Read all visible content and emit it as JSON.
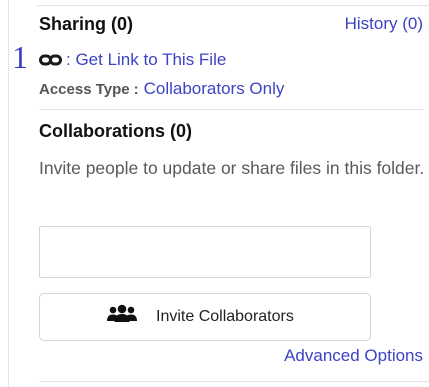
{
  "annotation": {
    "number": "1"
  },
  "sharing": {
    "title": "Sharing (0)",
    "history_link": "History (0)",
    "get_link_prefix": ": ",
    "get_link_label": "Get Link to This File",
    "access_type_label": "Access Type",
    "access_type_separator": ":",
    "access_type_value": "Collaborators Only"
  },
  "collaborations": {
    "title": "Collaborations (0)",
    "description": "Invite people to update or share files in this folder.",
    "input_value": "",
    "invite_button_label": "Invite Collaborators",
    "advanced_options_link": "Advanced Options"
  },
  "icons": {
    "link": "link-icon",
    "invite": "group-icon"
  },
  "colors": {
    "link": "#3c43c4",
    "annotation": "#3b3fc8",
    "heading": "#111111",
    "muted_text": "#5a5a5a",
    "border": "#d4d4d4"
  }
}
